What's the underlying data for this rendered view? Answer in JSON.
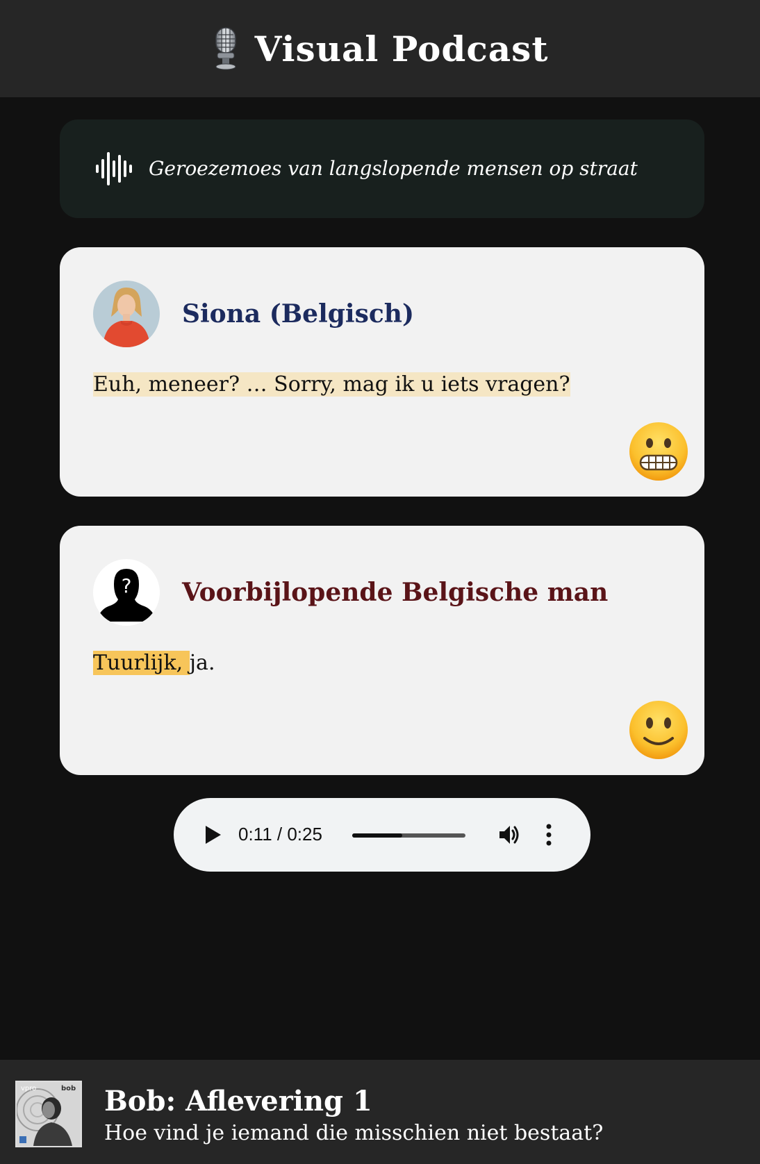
{
  "header": {
    "title": "Visual Podcast",
    "icon": "microphone-icon"
  },
  "ambient": {
    "icon": "sound-wave-icon",
    "text": "Geroezemoes van langslopende mensen op straat"
  },
  "cards": [
    {
      "speaker": "Siona (Belgisch)",
      "avatar": "speaker-photo",
      "line_highlighted": "Euh, meneer? … Sorry, mag ik u iets vragen?",
      "line_rest": "",
      "emoji": "grimacing-face-emoji",
      "name_color": "#1c2b5e"
    },
    {
      "speaker": "Voorbijlopende Belgische man",
      "avatar": "unknown-person-silhouette",
      "line_highlighted": "Tuurlijk, ",
      "line_rest": "ja.",
      "emoji": "slightly-smiling-face-emoji",
      "name_color": "#5a1418"
    }
  ],
  "player": {
    "time": "0:11 / 0:25",
    "progress": 0.44
  },
  "footer": {
    "title": "Bob: Aflevering 1",
    "subtitle": "Hoe vind je iemand die misschien niet bestaat?",
    "cover_labels": [
      "vpro",
      "bob"
    ]
  }
}
